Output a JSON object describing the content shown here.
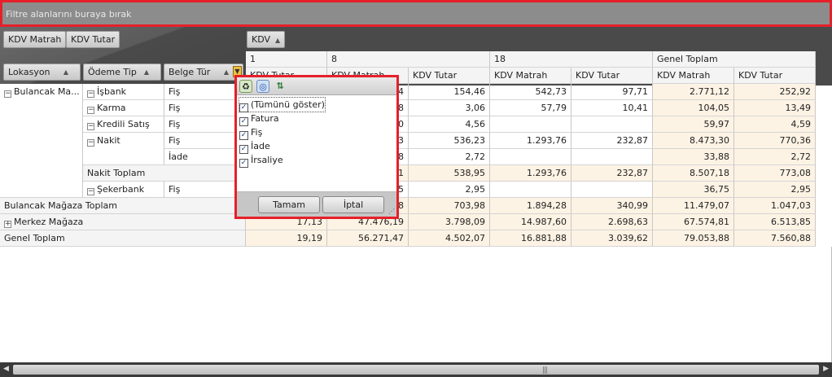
{
  "filter_area": {
    "placeholder": "Filtre alanlarını buraya bırak"
  },
  "data_fields": [
    "KDV Matrah",
    "KDV Tutar"
  ],
  "column_field": "KDV",
  "row_fields": [
    "Lokasyon",
    "Ödeme Tip",
    "Belge Tür"
  ],
  "column_values": [
    "1",
    "8",
    "18",
    "Genel Toplam"
  ],
  "measure_headers": [
    "KDV Tutar",
    "KDV Matrah",
    "KDV Tutar",
    "KDV Matrah",
    "KDV Tutar",
    "KDV Matrah",
    "KDV Tutar"
  ],
  "first_col_header_partial": "KDV Tutar",
  "rows": [
    {
      "lokasyon": "Bulancak Ma...",
      "odeme": "İşbank",
      "belge": "Fiş",
      "vals": [
        "",
        "4",
        "154,46",
        "542,73",
        "97,71",
        "2.771,12",
        "252,92"
      ]
    },
    {
      "lokasyon": "",
      "odeme": "Karma",
      "belge": "Fiş",
      "vals": [
        "",
        "8",
        "3,06",
        "57,79",
        "10,41",
        "104,05",
        "13,49"
      ]
    },
    {
      "lokasyon": "",
      "odeme": "Kredili Satış",
      "belge": "Fiş",
      "vals": [
        "",
        "0",
        "4,56",
        "",
        "",
        "59,97",
        "4,59"
      ]
    },
    {
      "lokasyon": "",
      "odeme": "Nakit",
      "belge": "Fiş",
      "vals": [
        "",
        "3",
        "536,23",
        "1.293,76",
        "232,87",
        "8.473,30",
        "770,36"
      ]
    },
    {
      "lokasyon": "",
      "odeme": "",
      "belge": "İade",
      "vals": [
        "",
        "8",
        "2,72",
        "",
        "",
        "33,88",
        "2,72"
      ]
    },
    {
      "lokasyon": "",
      "odeme": "Nakit Toplam",
      "belge": "",
      "vals": [
        "",
        "1",
        "538,95",
        "1.293,76",
        "232,87",
        "8.507,18",
        "773,08"
      ]
    },
    {
      "lokasyon": "",
      "odeme": "Şekerbank",
      "belge": "Fiş",
      "vals": [
        "",
        "5",
        "2,95",
        "",
        "",
        "36,75",
        "2,95"
      ]
    },
    {
      "lokasyon": "Bulancak Mağaza Toplam",
      "odeme": "",
      "belge": "",
      "vals": [
        "",
        "8",
        "703,98",
        "1.894,28",
        "340,99",
        "11.479,07",
        "1.047,03"
      ]
    },
    {
      "lokasyon": "Merkez Mağaza",
      "odeme": "",
      "belge": "",
      "vals": [
        "17,13",
        "47.476,19",
        "3.798,09",
        "14.987,60",
        "2.698,63",
        "67.574,81",
        "6.513,85"
      ]
    },
    {
      "lokasyon": "Genel Toplam",
      "odeme": "",
      "belge": "",
      "vals": [
        "19,19",
        "56.271,47",
        "4.502,07",
        "16.881,88",
        "3.039,62",
        "79.053,88",
        "7.560,88"
      ]
    }
  ],
  "filter_popup": {
    "items": [
      {
        "label": "(Tümünü göster)",
        "checked": true
      },
      {
        "label": "Fatura",
        "checked": true
      },
      {
        "label": "Fiş",
        "checked": true
      },
      {
        "label": "İade",
        "checked": true
      },
      {
        "label": "İrsaliye",
        "checked": true
      }
    ],
    "ok_label": "Tamam",
    "cancel_label": "İptal"
  },
  "colors": {
    "highlight_border": "#e5202a",
    "total_bg": "#fdf3e4",
    "dark_bg": "#4a4a4a"
  }
}
